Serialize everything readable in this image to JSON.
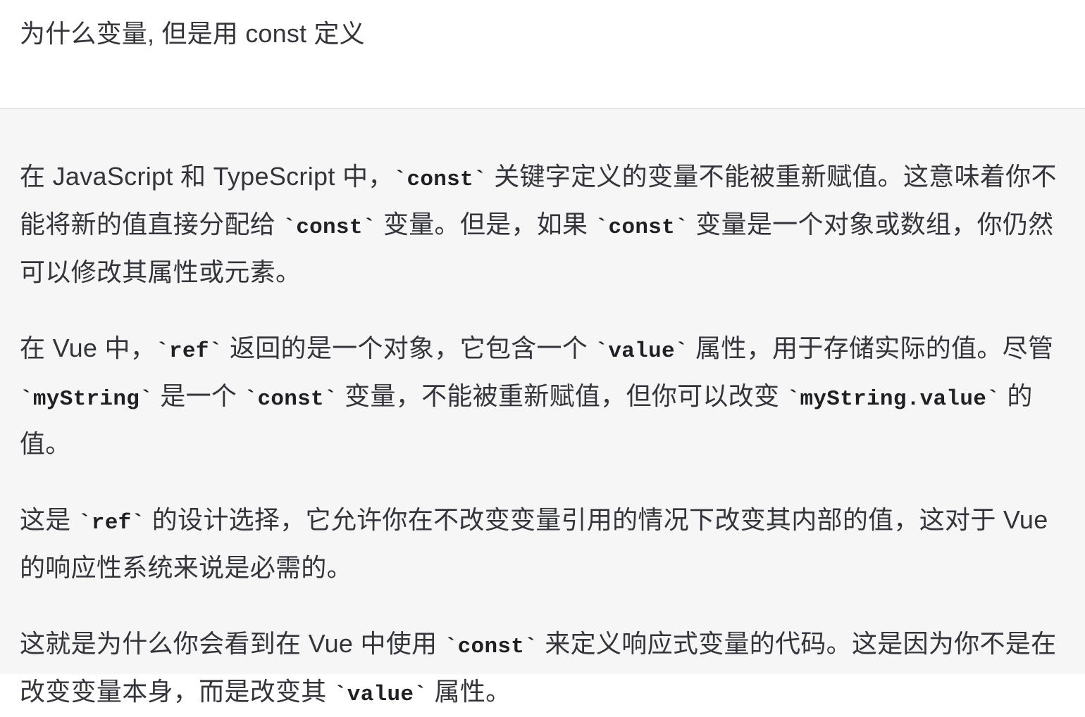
{
  "user_message": "为什么变量, 但是用 const 定义",
  "paragraphs": [
    [
      {
        "t": "text",
        "v": "在 JavaScript 和 TypeScript 中，"
      },
      {
        "t": "code",
        "v": "`const`"
      },
      {
        "t": "text",
        "v": " 关键字定义的变量不能被重新赋值。这意味着你不能将新的值直接分配给 "
      },
      {
        "t": "code",
        "v": "`const`"
      },
      {
        "t": "text",
        "v": " 变量。但是，如果 "
      },
      {
        "t": "code",
        "v": "`const`"
      },
      {
        "t": "text",
        "v": " 变量是一个对象或数组，你仍然可以修改其属性或元素。"
      }
    ],
    [
      {
        "t": "text",
        "v": "在 Vue 中，"
      },
      {
        "t": "code",
        "v": "`ref`"
      },
      {
        "t": "text",
        "v": " 返回的是一个对象，它包含一个 "
      },
      {
        "t": "code",
        "v": "`value`"
      },
      {
        "t": "text",
        "v": " 属性，用于存储实际的值。尽管 "
      },
      {
        "t": "code",
        "v": "`myString`"
      },
      {
        "t": "text",
        "v": " 是一个 "
      },
      {
        "t": "code",
        "v": "`const`"
      },
      {
        "t": "text",
        "v": " 变量，不能被重新赋值，但你可以改变 "
      },
      {
        "t": "code",
        "v": "`myString.value`"
      },
      {
        "t": "text",
        "v": " 的值。"
      }
    ],
    [
      {
        "t": "text",
        "v": "这是 "
      },
      {
        "t": "code",
        "v": "`ref`"
      },
      {
        "t": "text",
        "v": " 的设计选择，它允许你在不改变变量引用的情况下改变其内部的值，这对于 Vue 的响应性系统来说是必需的。"
      }
    ],
    [
      {
        "t": "text",
        "v": "这就是为什么你会看到在 Vue 中使用 "
      },
      {
        "t": "code",
        "v": "`const`"
      },
      {
        "t": "text",
        "v": " 来定义响应式变量的代码。这是因为你不是在改变变量本身，而是改变其 "
      },
      {
        "t": "code",
        "v": "`value`"
      },
      {
        "t": "text",
        "v": " 属性。"
      }
    ]
  ]
}
